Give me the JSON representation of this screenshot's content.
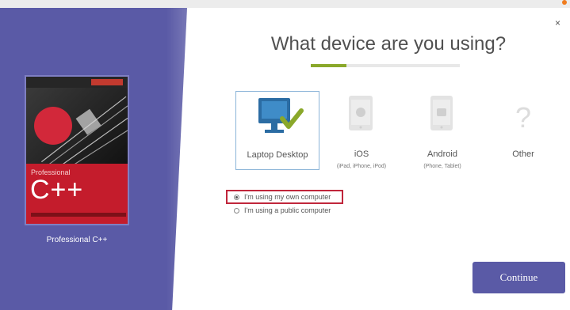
{
  "dialog": {
    "title": "What device are you using?",
    "progress_fraction": 0.24,
    "close_label": "×"
  },
  "book": {
    "cover_series": "Professional",
    "cover_title": "C++",
    "label": "Professional C++"
  },
  "devices": [
    {
      "label": "Laptop Desktop",
      "sub": "",
      "icon": "monitor-check-icon",
      "selected": true
    },
    {
      "label": "iOS",
      "sub": "(iPad, iPhone, iPod)",
      "icon": "apple-device-icon",
      "selected": false
    },
    {
      "label": "Android",
      "sub": "(Phone, Tablet)",
      "icon": "android-device-icon",
      "selected": false
    },
    {
      "label": "Other",
      "sub": "",
      "icon": "question-mark-icon",
      "selected": false
    }
  ],
  "computer_options": [
    {
      "label": "I'm using my own computer",
      "selected": true
    },
    {
      "label": "I'm using a public computer",
      "selected": false
    }
  ],
  "actions": {
    "continue_label": "Continue"
  },
  "colors": {
    "sidebar": "#5a5aa6",
    "accent_green": "#8aa82a",
    "highlight_red": "#c0263b",
    "monitor_blue": "#2b6ca3"
  }
}
